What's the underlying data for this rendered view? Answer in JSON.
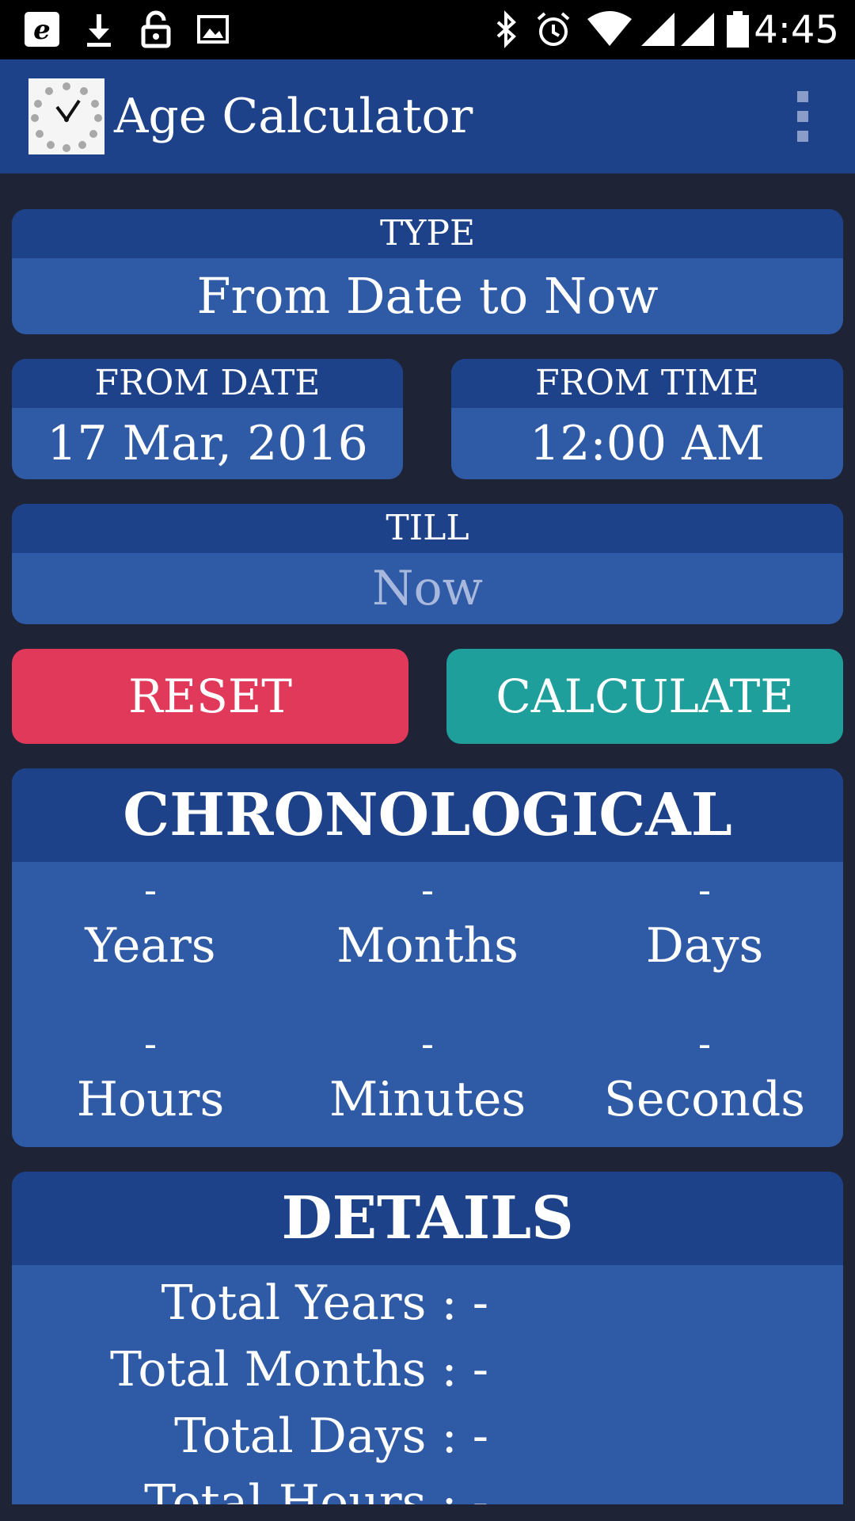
{
  "status_bar": {
    "time": "4:45",
    "icons": [
      "e-app-icon",
      "download-icon",
      "lock-icon",
      "image-icon",
      "bluetooth-icon",
      "alarm-icon",
      "wifi-icon",
      "signal-icon",
      "battery-icon"
    ]
  },
  "app_bar": {
    "title": "Age Calculator"
  },
  "type_card": {
    "label": "TYPE",
    "value": "From Date to Now"
  },
  "from_date": {
    "label": "FROM DATE",
    "value": "17 Mar, 2016"
  },
  "from_time": {
    "label": "FROM TIME",
    "value": "12:00 AM"
  },
  "till": {
    "label": "TILL",
    "value": "Now"
  },
  "buttons": {
    "reset": "RESET",
    "calculate": "CALCULATE"
  },
  "chronological": {
    "title": "CHRONOLOGICAL",
    "cells": [
      {
        "value": "-",
        "label": "Years"
      },
      {
        "value": "-",
        "label": "Months"
      },
      {
        "value": "-",
        "label": "Days"
      },
      {
        "value": "-",
        "label": "Hours"
      },
      {
        "value": "-",
        "label": "Minutes"
      },
      {
        "value": "-",
        "label": "Seconds"
      }
    ]
  },
  "details": {
    "title": "DETAILS",
    "rows": [
      {
        "label": "Total Years : -"
      },
      {
        "label": "Total Months : -"
      },
      {
        "label": "Total Days : -"
      },
      {
        "label": "Total Hours : -"
      }
    ]
  },
  "colors": {
    "background": "#1f2336",
    "header_blue": "#1e4289",
    "card_blue": "#2f5aa6",
    "reset_red": "#e0395a",
    "calculate_teal": "#1f9f9c",
    "placeholder_text": "#a8b8dc"
  }
}
